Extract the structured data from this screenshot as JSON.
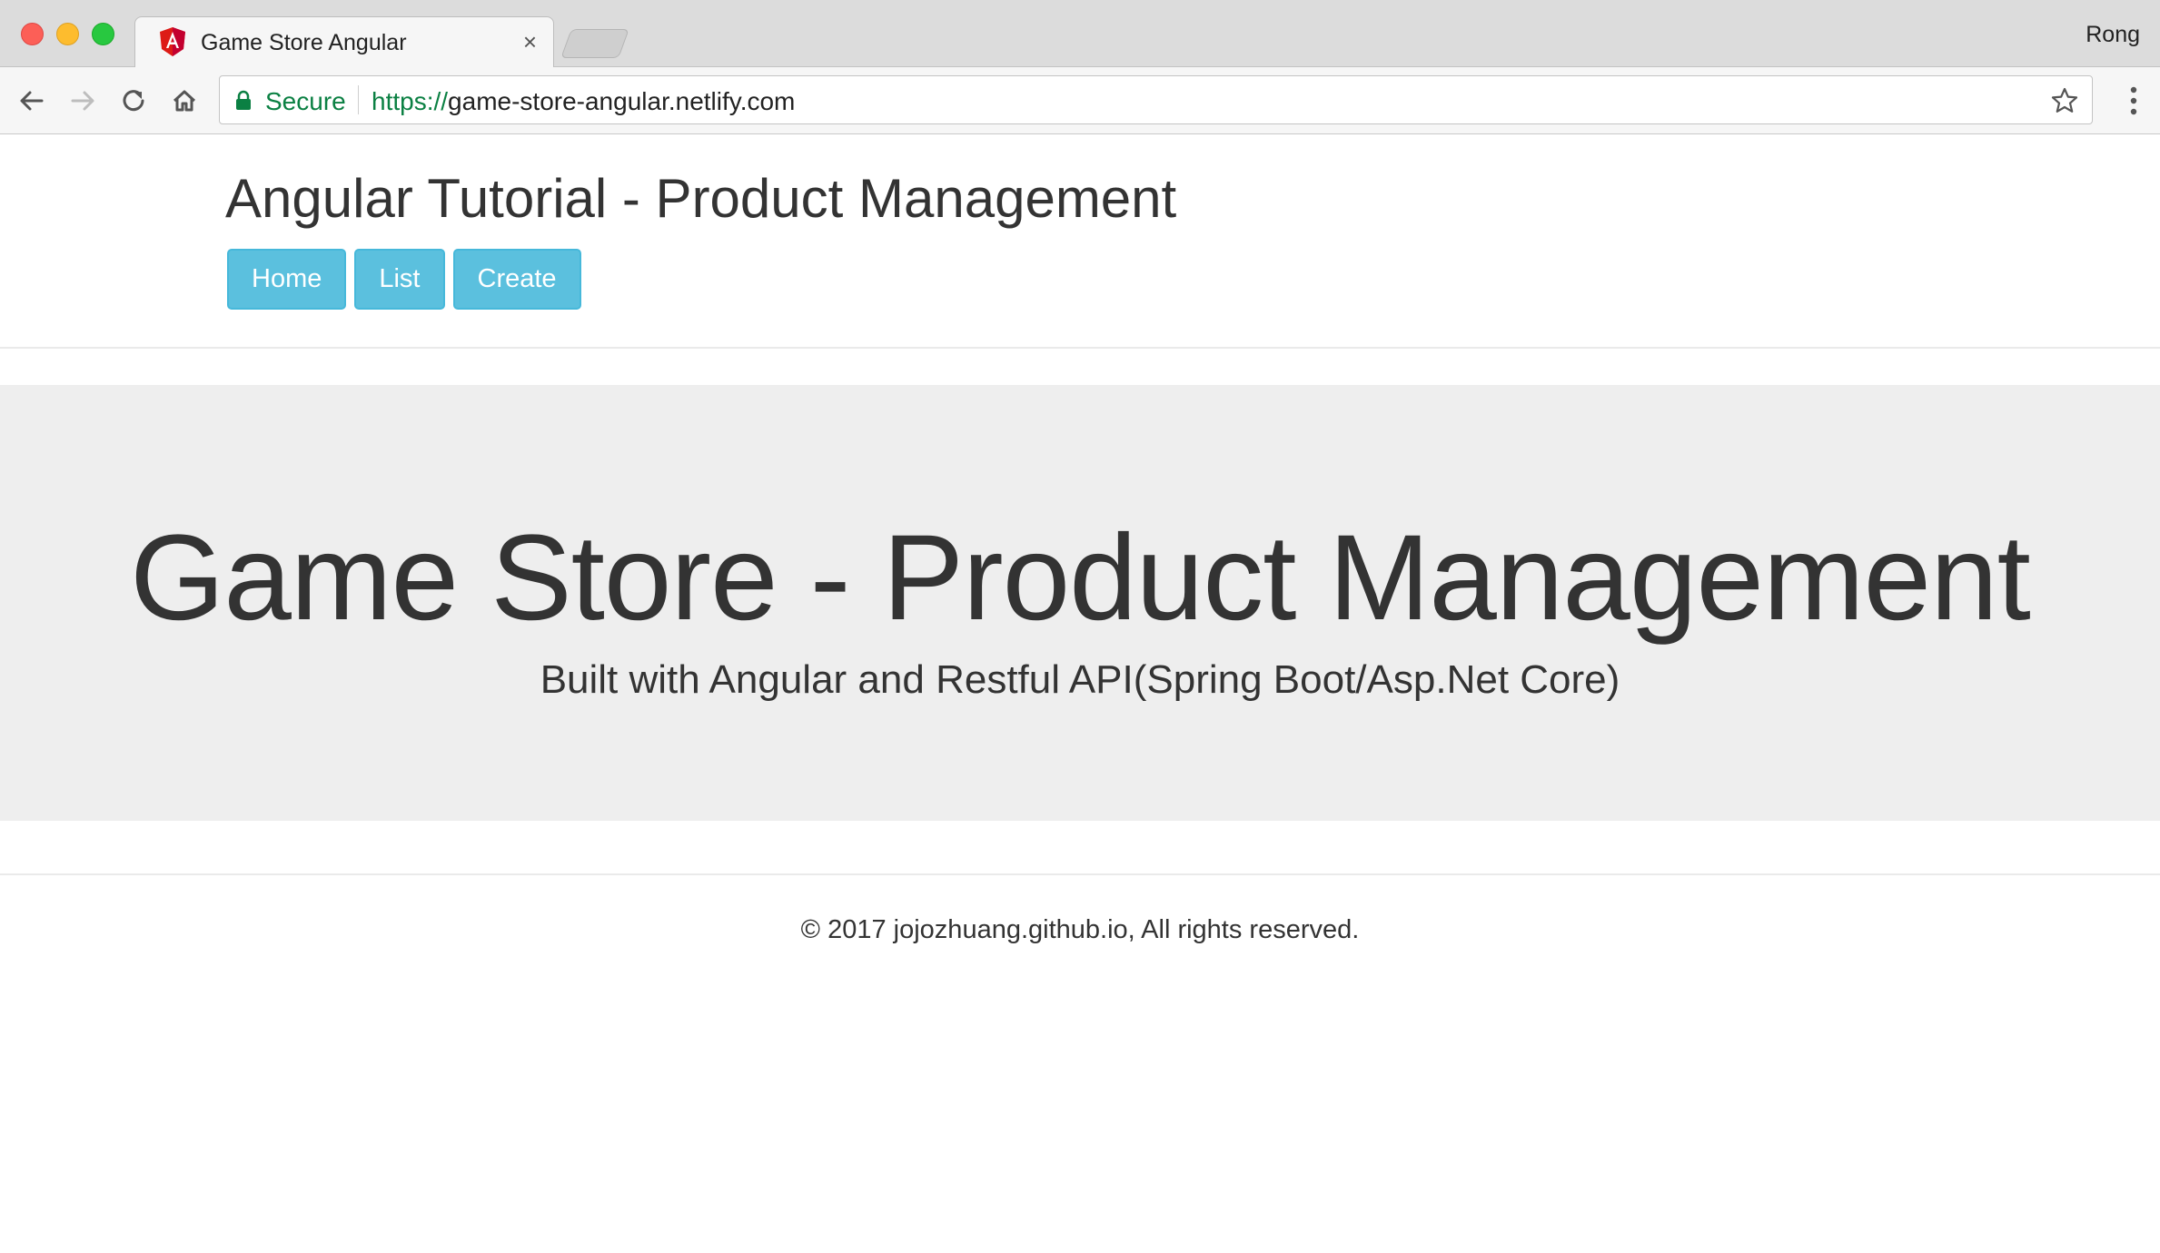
{
  "browser": {
    "tab": {
      "title": "Game Store Angular",
      "close_glyph": "×",
      "favicon": "angular-icon"
    },
    "profile_name": "Rong",
    "address_bar": {
      "security_label": "Secure",
      "url_scheme": "https://",
      "url_rest": "game-store-angular.netlify.com"
    },
    "icons": [
      "back-arrow-icon",
      "forward-arrow-icon",
      "reload-icon",
      "home-icon",
      "lock-icon",
      "star-icon",
      "menu-dots-icon"
    ]
  },
  "page": {
    "site_title": "Angular Tutorial - Product Management",
    "nav": [
      {
        "label": "Home"
      },
      {
        "label": "List"
      },
      {
        "label": "Create"
      }
    ],
    "jumbotron": {
      "title": "Game Store - Product Management",
      "subtitle": "Built with Angular and Restful API(Spring Boot/Asp.Net Core)"
    },
    "footer": {
      "text": "© 2017 jojozhuang.github.io, All rights reserved."
    }
  },
  "colors": {
    "nav_button": "#5bc0de",
    "jumbotron_bg": "#eeeeee",
    "secure_green": "#0b8043",
    "text": "#333333"
  }
}
